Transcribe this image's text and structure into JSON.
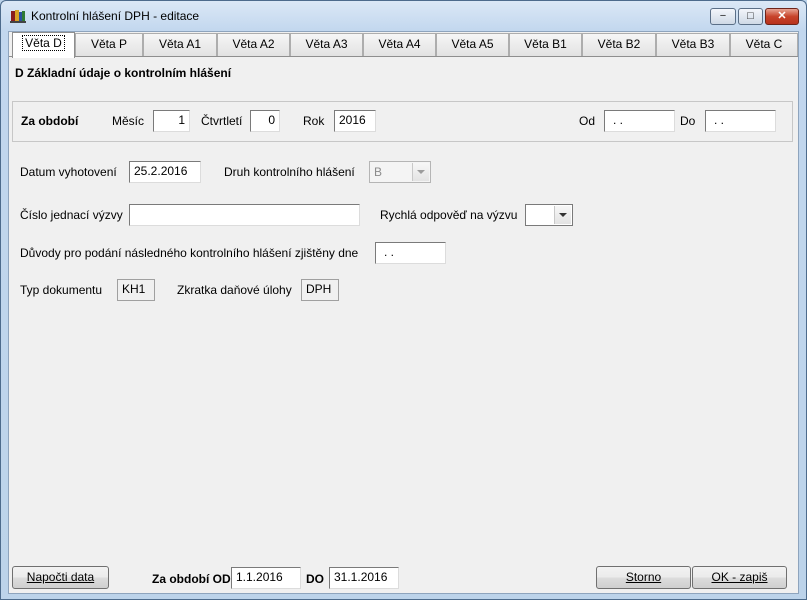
{
  "window": {
    "title": "Kontrolní hlášení DPH - editace",
    "minimize_glyph": "−",
    "maximize_glyph": "□",
    "close_glyph": "✕"
  },
  "tabs": [
    {
      "label": "Věta D"
    },
    {
      "label": "Věta P"
    },
    {
      "label": "Věta A1"
    },
    {
      "label": "Věta A2"
    },
    {
      "label": "Věta A3"
    },
    {
      "label": "Věta A4"
    },
    {
      "label": "Věta A5"
    },
    {
      "label": "Věta B1"
    },
    {
      "label": "Věta B2"
    },
    {
      "label": "Věta B3"
    },
    {
      "label": "Věta C"
    }
  ],
  "section": {
    "title": "D Základní údaje o kontrolním hlášení"
  },
  "period": {
    "label": "Za období",
    "month_label": "Měsíc",
    "month_value": "1",
    "quarter_label": "Čtvrtletí",
    "quarter_value": "0",
    "year_label": "Rok",
    "year_value": "2016",
    "from_label": "Od",
    "from_value": ". .",
    "to_label": "Do",
    "to_value": ". ."
  },
  "form": {
    "date_label": "Datum vyhotovení",
    "date_value": "25.2.2016",
    "type_label": "Druh kontrolního hlášení",
    "type_value": "B",
    "ref_label": "Číslo jednací výzvy",
    "ref_value": "",
    "quick_label": "Rychlá odpověď na výzvu",
    "quick_value": "",
    "reasons_label": "Důvody pro podání následného kontrolního hlášení zjištěny dne",
    "reasons_value": ". .",
    "doctype_label": "Typ dokumentu",
    "doctype_value": "KH1",
    "taskabbr_label": "Zkratka daňové úlohy",
    "taskabbr_value": "DPH"
  },
  "bottom": {
    "compute_button": "Napočti data",
    "period_from_label": "Za období OD",
    "period_from_value": "1.1.2016",
    "period_to_label": "DO",
    "period_to_value": "31.1.2016",
    "cancel_button": "Storno",
    "ok_button": "OK - zapiš"
  },
  "colors": {
    "window_frame": "#bcd3ea",
    "client_bg": "#f0f0f0",
    "close_button": "#c7432a"
  }
}
